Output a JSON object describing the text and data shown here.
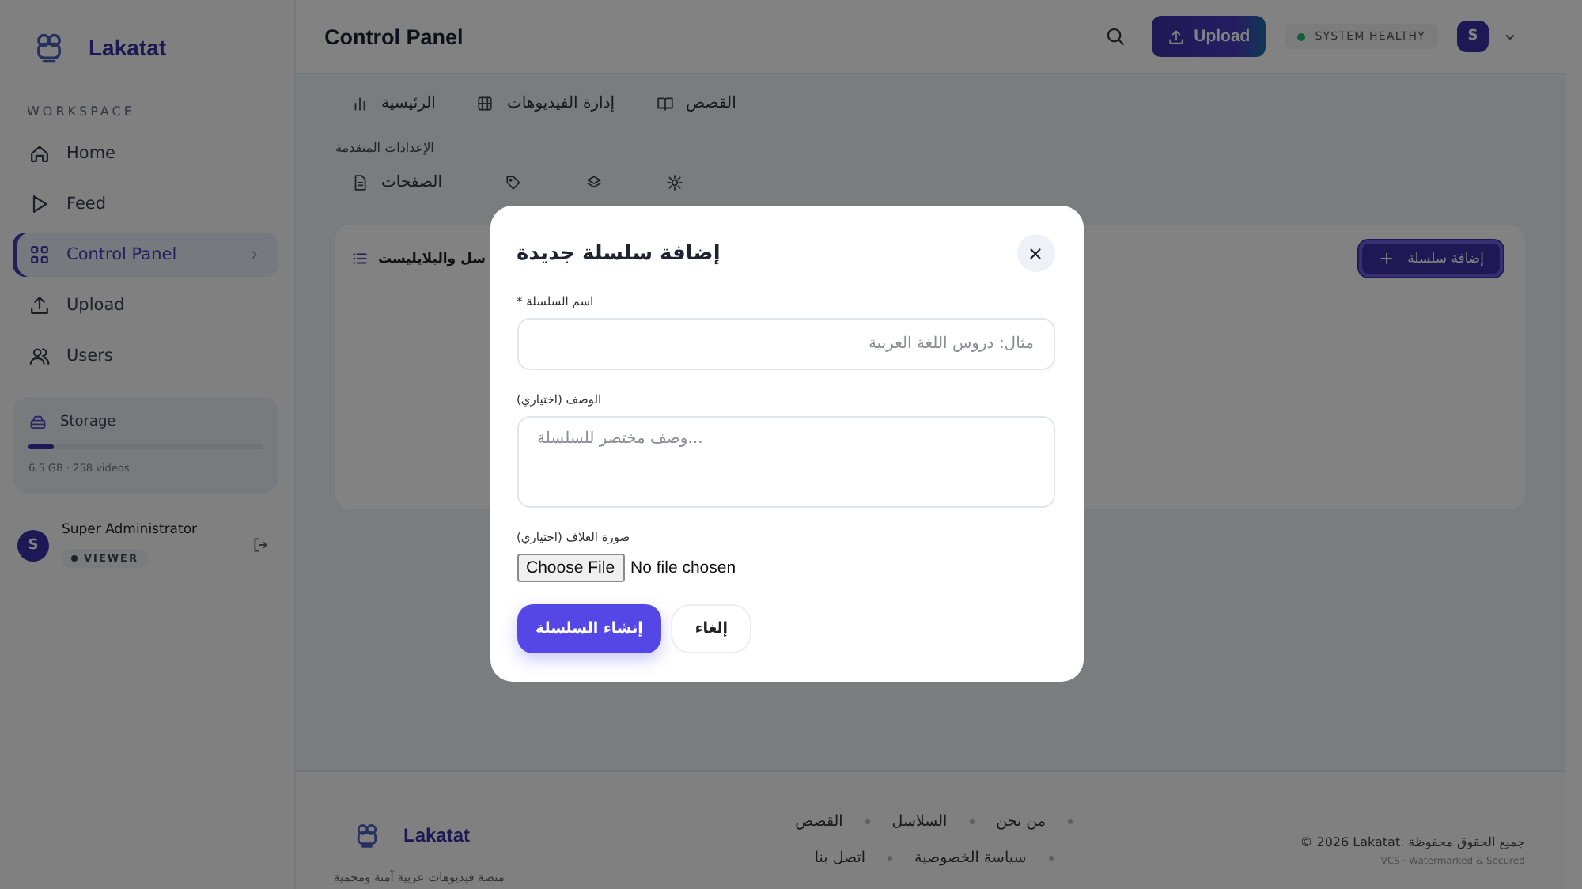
{
  "sidebar": {
    "brand": "Lakatat",
    "section_label": "WORKSPACE",
    "items": [
      {
        "label": "Home",
        "kind": "home",
        "selected": false
      },
      {
        "label": "Feed",
        "kind": "play",
        "selected": false
      },
      {
        "label": "Control Panel",
        "kind": "grid",
        "selected": true
      },
      {
        "label": "Upload",
        "kind": "upload",
        "selected": false
      },
      {
        "label": "Users",
        "kind": "users",
        "selected": false
      }
    ],
    "storage": {
      "title": "Storage",
      "level": 0.11,
      "detail": "6.5 GB · 258 videos"
    },
    "user": {
      "initial": "S",
      "name": "Super Administrator",
      "role": "VIEWER"
    }
  },
  "header": {
    "title": "Control Panel",
    "upload_button": "Upload",
    "status": "SYSTEM HEALTHY",
    "avatar_initial": "S"
  },
  "nav_tabs": [
    {
      "label": "القصص",
      "kind": "book"
    },
    {
      "label": "إدارة الفيديوهات",
      "kind": "film"
    },
    {
      "label": "الرئيسية",
      "kind": "chart"
    }
  ],
  "advanced": {
    "heading": "الإعدادات المتقدمة",
    "tabs": [
      {
        "kind": "gear"
      },
      {
        "kind": "layers"
      },
      {
        "kind": "tag"
      },
      {
        "label": "الصفحات",
        "kind": "page"
      }
    ]
  },
  "card": {
    "title": "سل والبلايليست",
    "add_button": "إضافة سلسلة"
  },
  "dialog": {
    "title": "إضافة سلسلة جديدة",
    "name_label": "* اسم السلسلة",
    "name_placeholder": "مثال: دروس اللغة العربية",
    "description_label": "الوصف (اختياري)",
    "description_placeholder": "...وصف مختصر للسلسلة",
    "cover_label": "صورة الغلاف (اختياري)",
    "choose_file": "Choose File",
    "no_file": "No file chosen",
    "create_button": "إنشاء السلسلة",
    "cancel_button": "إلغاء"
  },
  "footer": {
    "brand": "Lakatat",
    "tagline": "منصة فيديوهات عربية آمنة ومحمية",
    "links": [
      "من نحن",
      "السلاسل",
      "القصص",
      "سياسة الخصوصية",
      "اتصل بنا"
    ],
    "copyright": "© 2026 Lakatat. جميع الحقوق محفوظة",
    "note": "VCS · Watermarked & Secured"
  }
}
